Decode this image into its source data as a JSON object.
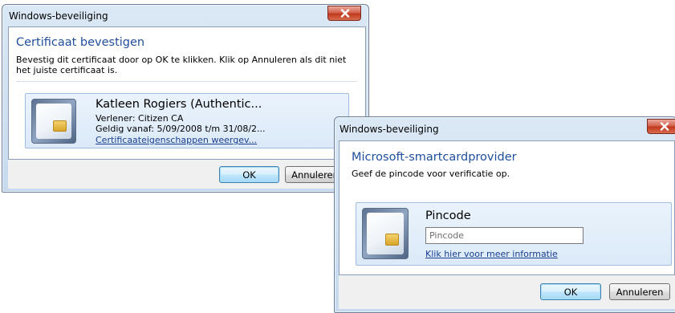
{
  "dialog1": {
    "window_title": "Windows-beveiliging",
    "heading": "Certificaat bevestigen",
    "message": "Bevestig dit certificaat door op OK te klikken. Klik op Annuleren als dit niet het juiste certificaat is.",
    "certificate": {
      "name": "Katleen Rogiers (Authentic...",
      "issuer": "Verlener: Citizen CA",
      "validity": "Geldig vanaf: 5/09/2008 t/m 31/08/2...",
      "properties_link": "Certificaateigenschappen weergev..."
    },
    "ok_label": "OK",
    "cancel_label": "Annuleren"
  },
  "dialog2": {
    "window_title": "Windows-beveiliging",
    "heading": "Microsoft-smartcardprovider",
    "message": "Geef de pincode voor verificatie op.",
    "pin_label": "Pincode",
    "pin_placeholder": "Pincode",
    "pin_value": "",
    "info_link": "Klik hier voor meer informatie",
    "ok_label": "OK",
    "cancel_label": "Annuleren"
  },
  "icons": {
    "close": "close-icon",
    "card": "smartcard-icon"
  }
}
